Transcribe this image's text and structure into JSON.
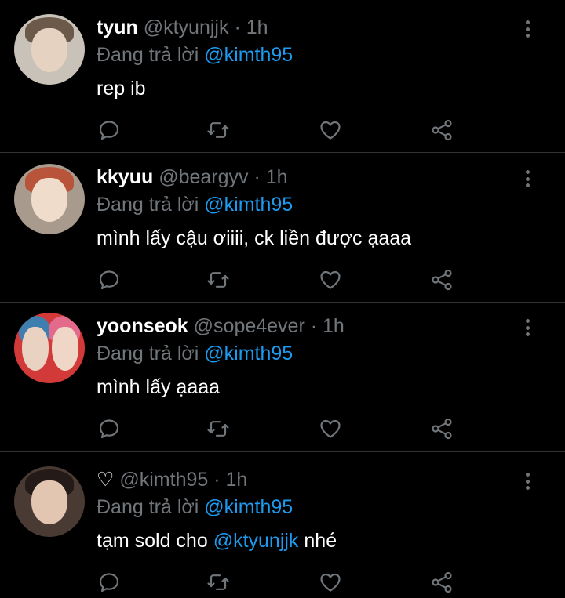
{
  "colors": {
    "background": "#000000",
    "text": "#ffffff",
    "secondary": "#71767b",
    "mention": "#1d9bf0",
    "divider": "#2f3336"
  },
  "reply_prefix": "Đang trả lời",
  "icons": [
    "comment-icon",
    "retweet-icon",
    "heart-icon",
    "share-icon",
    "more-vertical-icon"
  ],
  "tweets": [
    {
      "display_name": "tyun",
      "handle": "@ktyunjjk",
      "separator": "·",
      "time": "1h",
      "reply_to": "@kimth95",
      "text": "rep ib"
    },
    {
      "display_name": "kkyuu",
      "handle": "@beargyv",
      "separator": "·",
      "time": "1h",
      "reply_to": "@kimth95",
      "text": "mình lấy cậu ơiiii, ck liền được ạaaa"
    },
    {
      "display_name": "yoonseok",
      "handle": "@sope4ever",
      "separator": "·",
      "time": "1h",
      "reply_to": "@kimth95",
      "text": "mình lấy ạaaa"
    },
    {
      "display_name": "♡",
      "handle": "@kimth95",
      "separator": "·",
      "time": "1h",
      "reply_to": "@kimth95",
      "text_before": "tạm sold cho ",
      "text_mention": "@ktyunjjk",
      "text_after": " nhé"
    }
  ]
}
